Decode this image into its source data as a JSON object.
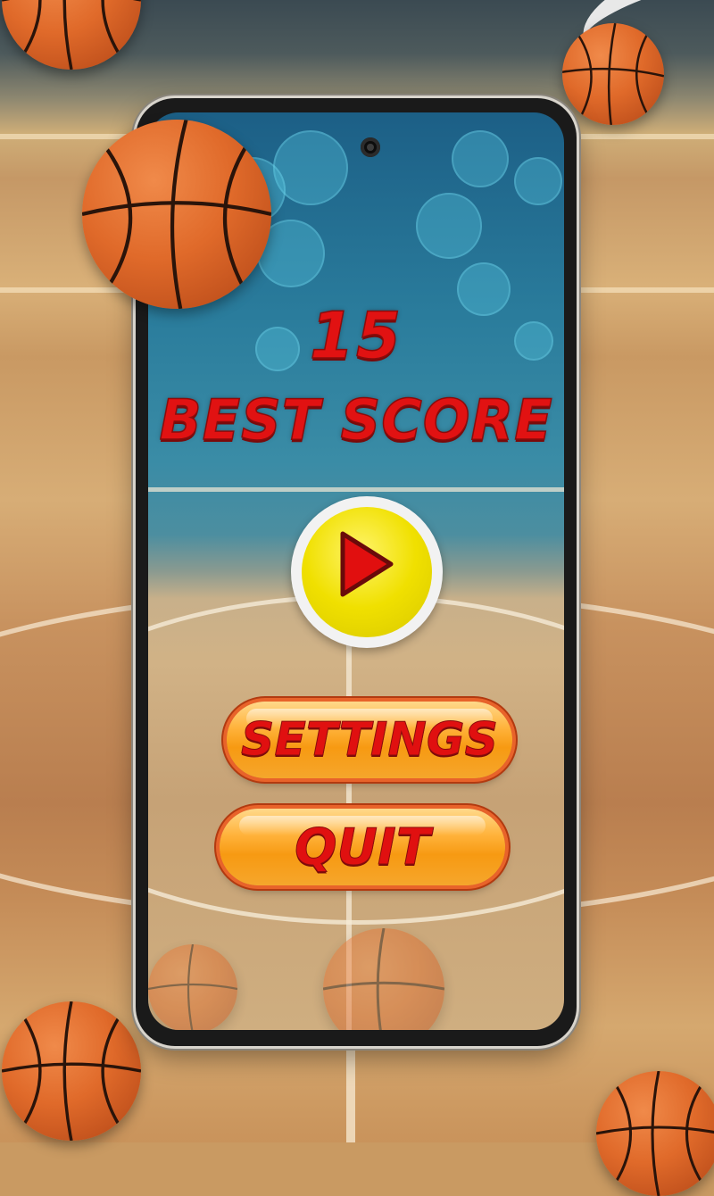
{
  "game": {
    "current_score": "15",
    "best_score_label": "BEST SCORE"
  },
  "menu": {
    "play_icon": "play-icon",
    "settings_label": "SETTINGS",
    "quit_label": "QUIT"
  },
  "colors": {
    "score_text": "#e11212",
    "play_button": "#f0e000",
    "pill_button": "#f79a12",
    "ball": "#e06a2a"
  }
}
